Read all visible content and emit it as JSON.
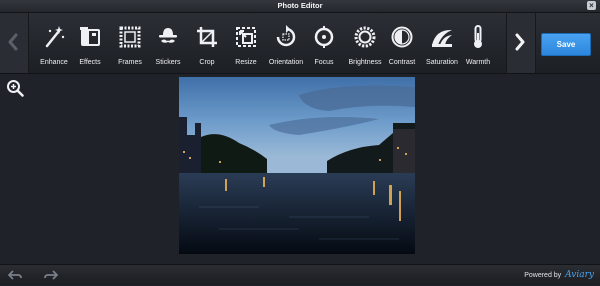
{
  "window": {
    "title": "Photo Editor"
  },
  "toolbar": {
    "tools": [
      {
        "label": "Enhance",
        "icon": "magic-wand-icon"
      },
      {
        "label": "Effects",
        "icon": "effects-icon"
      },
      {
        "label": "Frames",
        "icon": "frames-icon"
      },
      {
        "label": "Stickers",
        "icon": "stickers-icon"
      },
      {
        "label": "Crop",
        "icon": "crop-icon"
      },
      {
        "label": "Resize",
        "icon": "resize-icon"
      },
      {
        "label": "Orientation",
        "icon": "rotate-icon"
      },
      {
        "label": "Focus",
        "icon": "focus-icon"
      },
      {
        "label": "Brightness",
        "icon": "brightness-icon"
      },
      {
        "label": "Contrast",
        "icon": "contrast-icon"
      },
      {
        "label": "Saturation",
        "icon": "saturation-icon"
      },
      {
        "label": "Warmth",
        "icon": "thermometer-icon"
      }
    ],
    "save_label": "Save"
  },
  "footer": {
    "powered_by": "Powered by",
    "brand": "Aviary"
  },
  "colors": {
    "accent": "#3a96e8",
    "background": "#1f2228",
    "toolbar": "#24272c"
  }
}
